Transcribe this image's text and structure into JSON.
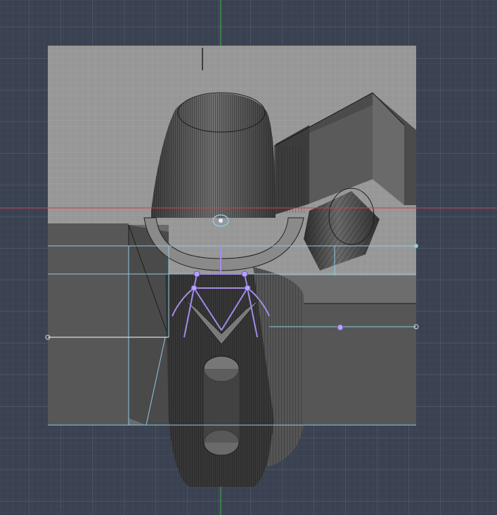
{
  "viewport": {
    "name": "3d-modeling-viewport",
    "background_color": "#3a4150",
    "grid_minor_color": "#4a5264",
    "grid_major_color": "#556077",
    "axis_x_color": "#c0454f",
    "axis_y_color": "#3fa04a",
    "selection_color": "#a48be8",
    "guide_color": "#8ec9e0",
    "model_dark": "#3c3c3c",
    "model_mid": "#5a5a5a",
    "model_light": "#8e8e8e",
    "backdrop_plane": "#9a9a9a"
  }
}
